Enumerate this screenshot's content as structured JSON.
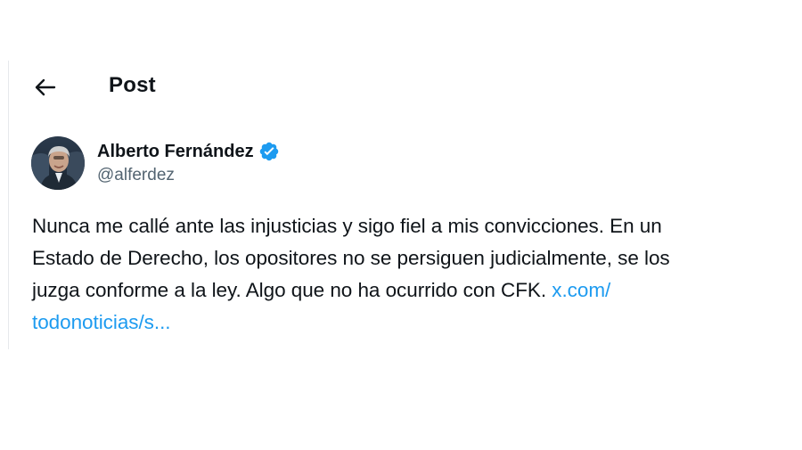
{
  "header": {
    "back_icon": "arrow-left-icon",
    "title": "Post"
  },
  "author": {
    "avatar_icon": "profile-photo",
    "display_name": "Alberto Fernández",
    "verified_icon": "verified-badge-icon",
    "handle": "@alferdez"
  },
  "post": {
    "lines": [
      "Nunca me callé ante las injusticias y sigo fiel a mis convicciones. En un",
      "Estado de Derecho, los opositores no se persiguen judicialmente, se los",
      "juzga conforme a la ley. Algo que no ha ocurrido con CFK."
    ],
    "link_part1": "x.com/",
    "link_part2": "todonoticias/s..."
  },
  "colors": {
    "text": "#0f1419",
    "secondary": "#536471",
    "link": "#1d9bf0",
    "verified": "#1d9bf0"
  }
}
